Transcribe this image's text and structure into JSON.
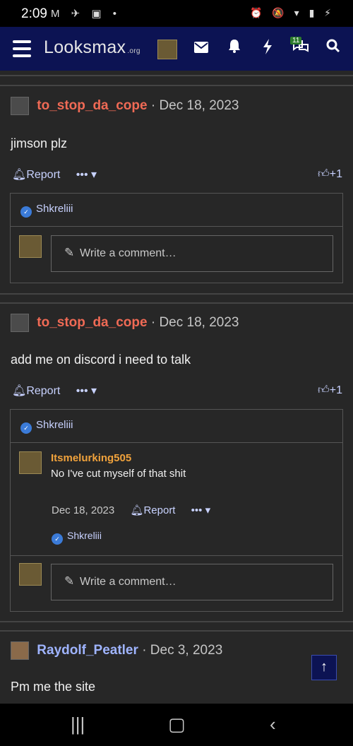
{
  "status_bar": {
    "time": "2:09",
    "left_icons": "M ✈ ▣ •",
    "right_icons": "⏰ 🔕 ▾ ▮ ⚡"
  },
  "header": {
    "logo_text": "Looksmax",
    "logo_suffix": ".org",
    "icons": [
      "menu-icon",
      "envelope-icon",
      "bell-icon",
      "bolt-icon",
      "chat-icon",
      "search-icon"
    ],
    "chat_badge": "11"
  },
  "posts": [
    {
      "username": "to_stop_da_cope",
      "date": "Dec 18, 2023",
      "body": "jimson plz",
      "report_label": "Report",
      "more_label": "•••",
      "like_count": "+1",
      "reaction_user": "Shkreliii",
      "write_placeholder": "Write a comment…"
    },
    {
      "username": "to_stop_da_cope",
      "date": "Dec 18, 2023",
      "body": "add me on discord i need to talk",
      "report_label": "Report",
      "more_label": "•••",
      "like_count": "+1",
      "reaction_user": "Shkreliii",
      "reply": {
        "username": "Itsmelurking505",
        "text": "No I've cut myself of that shit",
        "date": "Dec 18, 2023",
        "report_label": "Report",
        "more_label": "•••",
        "reaction_user": "Shkreliii"
      },
      "write_placeholder": "Write a comment…"
    },
    {
      "username": "Raydolf_Peatler",
      "date": "Dec 3, 2023",
      "body": "Pm me the site"
    }
  ],
  "colors": {
    "header_bg": "#0c1353",
    "page_bg": "#272727",
    "username_red": "#f06a55",
    "username_orange": "#f0a23c",
    "username_blue": "#9fb4ff",
    "link": "#c8d2ff"
  }
}
